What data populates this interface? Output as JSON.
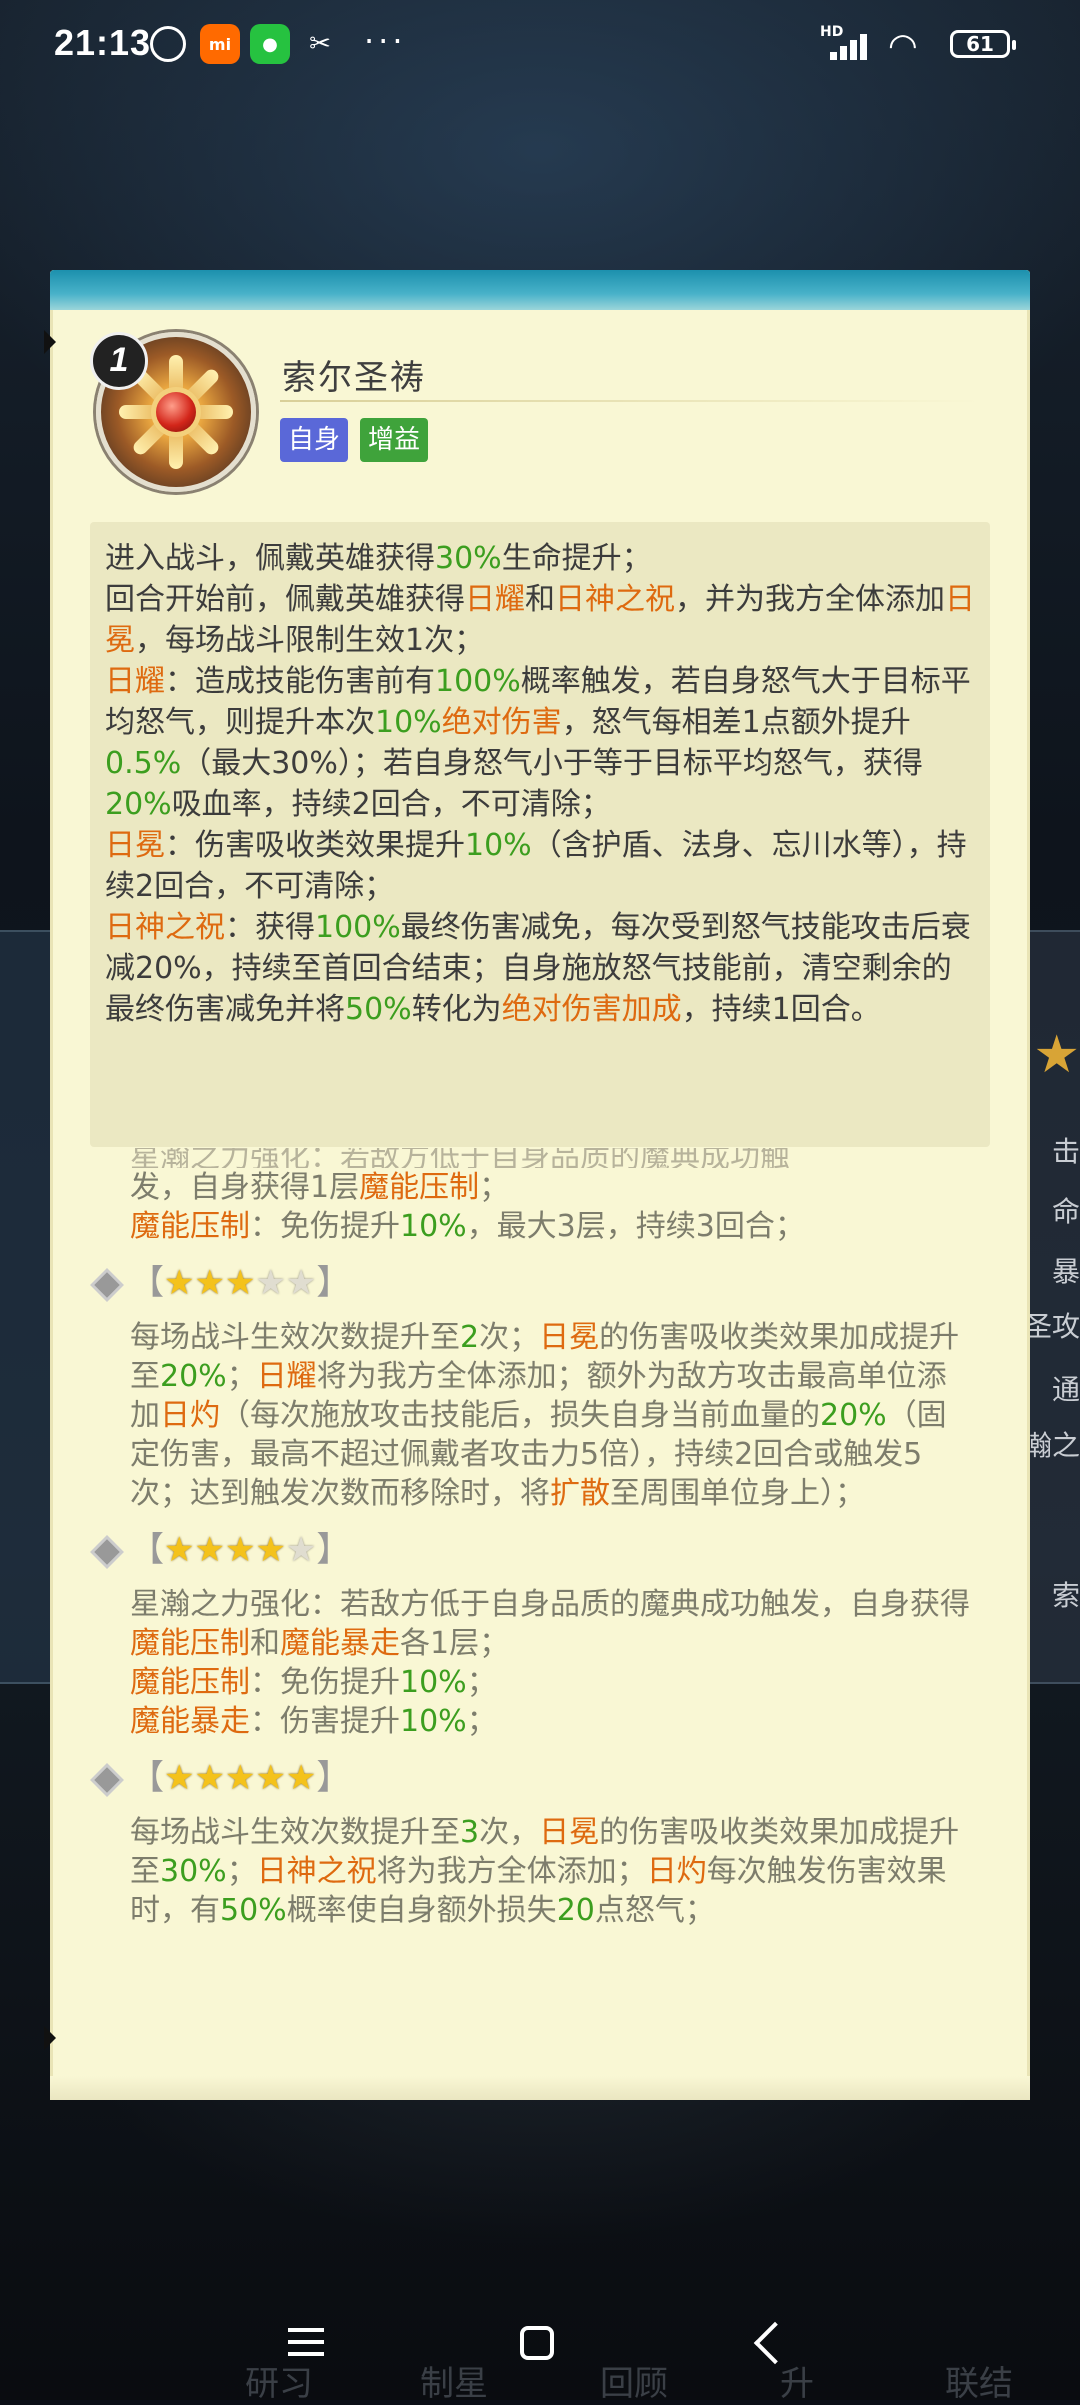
{
  "status_bar": {
    "time": "21:13",
    "mi_label": "mi",
    "hd_label": "HD",
    "battery": "61",
    "more": "···",
    "icons": [
      "alarm-icon",
      "mi-app-icon",
      "wechat-icon",
      "capcut-icon",
      "signal-icon",
      "wifi-icon",
      "battery-icon"
    ]
  },
  "background": {
    "right_peek": [
      "击",
      "命",
      "暴",
      "圣攻",
      "通",
      "瀚之",
      "索"
    ],
    "bottom_labels": [
      "研习",
      "制星",
      "回顾",
      "升",
      "联结"
    ]
  },
  "item": {
    "level": "1",
    "name": "索尔圣祷",
    "tags": [
      "自身",
      "增益"
    ]
  },
  "description": {
    "p1": [
      "进入战斗，佩戴英雄获得",
      "30%",
      "生命提升；"
    ],
    "p2": [
      "回合开始前，佩戴英雄获得",
      "日耀",
      "和",
      "日神之祝",
      "，并为我方全体添加",
      "日冕",
      "，每场战斗限制生效1次；"
    ],
    "p3": [
      "日耀",
      "：造成技能伤害前有",
      "100%",
      "概率触发，若自身怒气大于目标平均怒气，则提升本次",
      "10%",
      "绝对伤害",
      "，怒气每相差1点额外提升",
      "0.5%",
      "（最大30%）；若自身怒气小于等于目标平均怒气，获得",
      "20%",
      "吸血率，持续2回合，不可清除；"
    ],
    "p4": [
      "日冕",
      "：伤害吸收类效果提升",
      "10%",
      "（含护盾、法身、忘川水等），持续2回合，不可清除；"
    ],
    "p5": [
      "日神之祝",
      "：获得",
      "100%",
      "最终伤害减免，每次受到怒气技能攻击后衰减20%，持续至首回合结束；自身施放怒气技能前，清空剩余的最终伤害减免并将",
      "50%",
      "转化为",
      "绝对伤害加成",
      "，持续1回合。"
    ]
  },
  "tiers": {
    "partial_first_line": "星瀚之力强化：若敌方低于自身品质的魔典成功触",
    "top_line": [
      "发，自身获得1层",
      "魔能压制",
      "；"
    ],
    "top_line2": [
      "魔能压制",
      "：免伤提升",
      "10%",
      "，最大3层，持续3回合；"
    ],
    "tier3": {
      "bracket_open": "【",
      "bracket_close": "】",
      "stars_on": 3,
      "stars_total": 5,
      "text": [
        "每场战斗生效次数提升至",
        "2",
        "次；",
        "日冕",
        "的伤害吸收类效果加成提升至",
        "20%",
        "；",
        "日耀",
        "将为我方全体添加；额外为敌方攻击最高单位添加",
        "日灼",
        "（每次施放攻击技能后，损失自身当前血量的",
        "20%",
        "（固定伤害，最高不超过佩戴者攻击力5倍），持续2回合或触发5次；达到触发次数而移除时，将",
        "扩散",
        "至周围单位身上）；"
      ]
    },
    "tier4": {
      "bracket_open": "【",
      "bracket_close": "】",
      "stars_on": 4,
      "stars_total": 5,
      "text1": [
        "星瀚之力强化：若敌方低于自身品质的魔典成功触发，自身获得",
        "魔能压制",
        "和",
        "魔能暴走",
        "各1层；"
      ],
      "text2": [
        "魔能压制",
        "：免伤提升",
        "10%",
        "；"
      ],
      "text3": [
        "魔能暴走",
        "：伤害提升",
        "10%",
        "；"
      ]
    },
    "tier5": {
      "bracket_open": "【",
      "bracket_close": "】",
      "stars_on": 5,
      "stars_total": 5,
      "text": [
        "每场战斗生效次数提升至",
        "3",
        "次，",
        "日冕",
        "的伤害吸收类效果加成提升至",
        "30%",
        "；",
        "日神之祝",
        "将为我方全体添加；",
        "日灼",
        "每次触发伤害效果时，有",
        "50%",
        "概率使自身额外损失",
        "20",
        "点怒气；"
      ]
    }
  },
  "colors": {
    "panel_bg": "#f9f7d4",
    "highlight_orange": "#de6a10",
    "highlight_green": "#3c9e1f",
    "tag_self": "#5a68d8",
    "tag_buff": "#3fa33b",
    "star_on": "#f4c21b"
  },
  "nav": {
    "icons": [
      "menu-icon",
      "home-icon",
      "back-icon"
    ]
  }
}
